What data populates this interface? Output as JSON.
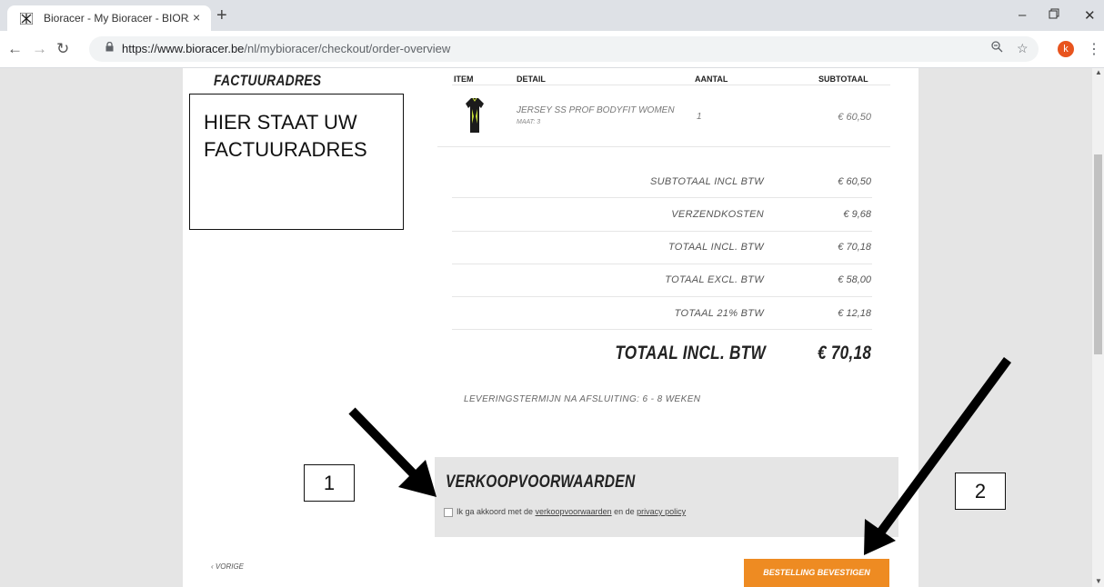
{
  "browser": {
    "tab_title": "Bioracer - My Bioracer - BIORACER",
    "tab_close": "×",
    "new_tab": "+",
    "url_host": "https://www.bioracer.be",
    "url_path": "/nl/mybioracer/checkout/order-overview",
    "profile_initial": "k"
  },
  "billing": {
    "heading": "FACTUURADRES",
    "placeholder_line1": "HIER STAAT UW",
    "placeholder_line2": "FACTUURADRES"
  },
  "order_table": {
    "headers": [
      "ITEM",
      "DETAIL",
      "AANTAL",
      "SUBTOTAAL"
    ],
    "items": [
      {
        "name": "JERSEY SS PROF BODYFIT WOMEN",
        "size": "MAAT: 3",
        "qty": "1",
        "subtotal": "€ 60,50"
      }
    ]
  },
  "totals": [
    {
      "label": "SUBTOTAAL INCL BTW",
      "value": "€ 60,50"
    },
    {
      "label": "VERZENDKOSTEN",
      "value": "€ 9,68"
    },
    {
      "label": "TOTAAL INCL. BTW",
      "value": "€ 70,18"
    },
    {
      "label": "TOTAAL EXCL. BTW",
      "value": "€ 58,00"
    },
    {
      "label": "TOTAAL 21% BTW",
      "value": "€ 12,18"
    }
  ],
  "grand_total": {
    "label": "TOTAAL INCL. BTW",
    "value": "€ 70,18"
  },
  "delivery_note": "LEVERINGSTERMIJN NA AFSLUITING: 6 - 8 WEKEN",
  "terms": {
    "heading": "VERKOOPVOORWAARDEN",
    "text_before": "Ik ga akkoord met de ",
    "link_terms": "verkoopvoorwaarden",
    "text_middle": " en de ",
    "link_privacy": "privacy policy"
  },
  "nav": {
    "prev_label": "‹ VORIGE",
    "confirm_label": "BESTELLING BEVESTIGEN"
  },
  "annotations": {
    "callout_1": "1",
    "callout_2": "2"
  },
  "colors": {
    "accent": "#ee8b22",
    "page_bg": "#ffffff",
    "side_bg": "#e5e5e5"
  }
}
